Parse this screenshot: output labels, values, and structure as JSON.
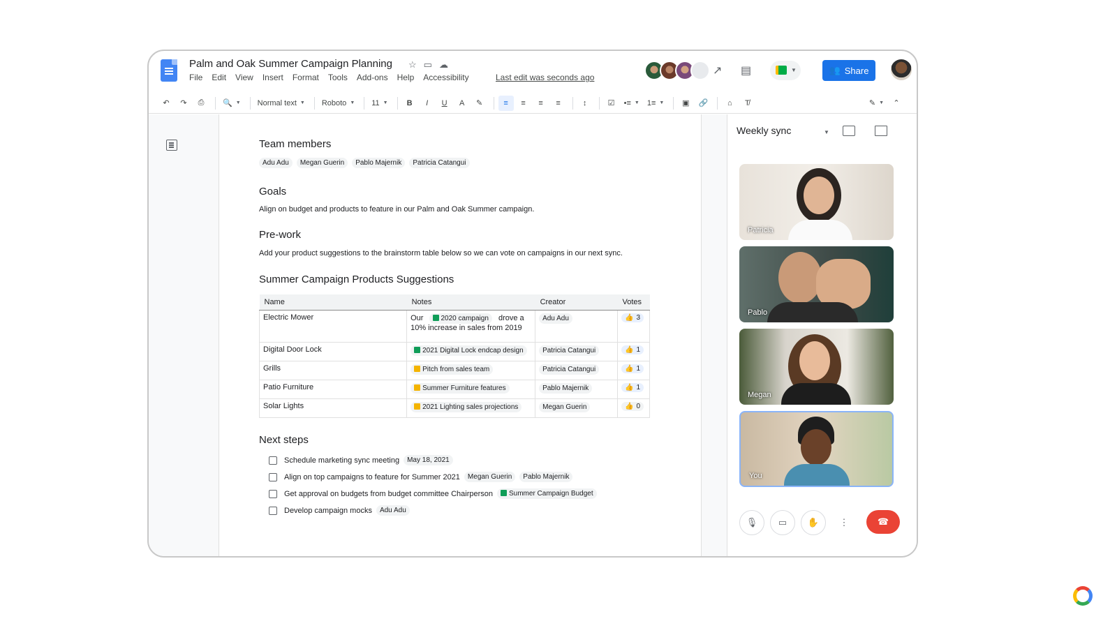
{
  "doc": {
    "title": "Palm and Oak Summer Campaign Planning",
    "menu": [
      "File",
      "Edit",
      "View",
      "Insert",
      "Format",
      "Tools",
      "Add-ons",
      "Help",
      "Accessibility"
    ],
    "last_edit": "Last edit was seconds ago",
    "share_label": "Share"
  },
  "toolbar": {
    "style": "Normal text",
    "font": "Roboto",
    "size": "11"
  },
  "content": {
    "team_heading": "Team members",
    "team_members": [
      "Adu Adu",
      "Megan Guerin",
      "Pablo Majernik",
      "Patricia Catangui"
    ],
    "goals_heading": "Goals",
    "goals_text": "Align on budget and products to feature in our Palm and Oak Summer campaign.",
    "prework_heading": "Pre-work",
    "prework_text": "Add your product suggestions to the brainstorm table below so we can vote on campaigns in our next sync.",
    "table_heading": "Summer Campaign Products Suggestions",
    "table_headers": [
      "Name",
      "Notes",
      "Creator",
      "Votes"
    ],
    "rows": [
      {
        "name": "Electric Mower",
        "note_pre": "Our",
        "note_chip": "2020 campaign",
        "note_post": "drove a 10% increase in sales from 2019",
        "creator": "Adu Adu",
        "votes": "3"
      },
      {
        "name": "Digital Door Lock",
        "note_chip": "2021 Digital Lock endcap design",
        "creator": "Patricia Catangui",
        "votes": "1"
      },
      {
        "name": "Grills",
        "note_chip": "Pitch from sales team",
        "creator": "Patricia Catangui",
        "votes": "1"
      },
      {
        "name": "Patio Furniture",
        "note_chip": "Summer Furniture features",
        "creator": "Pablo Majernik",
        "votes": "1"
      },
      {
        "name": "Solar Lights",
        "note_chip": "2021 Lighting sales projections",
        "creator": "Megan Guerin",
        "votes": "0"
      }
    ],
    "next_heading": "Next steps",
    "steps": [
      {
        "text": "Schedule marketing sync meeting",
        "chips": [
          "May 18, 2021"
        ]
      },
      {
        "text": "Align on top campaigns to feature for Summer 2021",
        "chips": [
          "Megan Guerin",
          "Pablo Majernik"
        ]
      },
      {
        "text": "Get approval on budgets from budget committee Chairperson",
        "chips": [
          "Summer Campaign Budget"
        ]
      },
      {
        "text": "Develop campaign mocks",
        "chips": [
          "Adu Adu"
        ]
      }
    ]
  },
  "meet": {
    "title": "Weekly sync",
    "participants": [
      "Patricia",
      "Pablo",
      "Megan",
      "You"
    ]
  },
  "colors": {
    "share_blue": "#1a73e8",
    "end_call_red": "#ea4335",
    "sheet_green": "#0f9d58",
    "slides_yellow": "#f4b400"
  }
}
